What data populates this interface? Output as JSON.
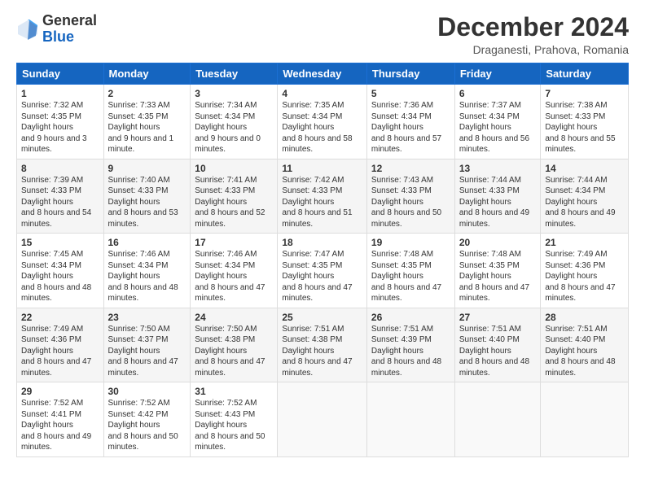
{
  "header": {
    "logo_general": "General",
    "logo_blue": "Blue",
    "month_title": "December 2024",
    "location": "Draganesti, Prahova, Romania"
  },
  "days_of_week": [
    "Sunday",
    "Monday",
    "Tuesday",
    "Wednesday",
    "Thursday",
    "Friday",
    "Saturday"
  ],
  "weeks": [
    [
      {
        "day": 1,
        "sunrise": "7:32 AM",
        "sunset": "4:35 PM",
        "daylight": "9 hours and 3 minutes."
      },
      {
        "day": 2,
        "sunrise": "7:33 AM",
        "sunset": "4:35 PM",
        "daylight": "9 hours and 1 minute."
      },
      {
        "day": 3,
        "sunrise": "7:34 AM",
        "sunset": "4:34 PM",
        "daylight": "9 hours and 0 minutes."
      },
      {
        "day": 4,
        "sunrise": "7:35 AM",
        "sunset": "4:34 PM",
        "daylight": "8 hours and 58 minutes."
      },
      {
        "day": 5,
        "sunrise": "7:36 AM",
        "sunset": "4:34 PM",
        "daylight": "8 hours and 57 minutes."
      },
      {
        "day": 6,
        "sunrise": "7:37 AM",
        "sunset": "4:34 PM",
        "daylight": "8 hours and 56 minutes."
      },
      {
        "day": 7,
        "sunrise": "7:38 AM",
        "sunset": "4:33 PM",
        "daylight": "8 hours and 55 minutes."
      }
    ],
    [
      {
        "day": 8,
        "sunrise": "7:39 AM",
        "sunset": "4:33 PM",
        "daylight": "8 hours and 54 minutes."
      },
      {
        "day": 9,
        "sunrise": "7:40 AM",
        "sunset": "4:33 PM",
        "daylight": "8 hours and 53 minutes."
      },
      {
        "day": 10,
        "sunrise": "7:41 AM",
        "sunset": "4:33 PM",
        "daylight": "8 hours and 52 minutes."
      },
      {
        "day": 11,
        "sunrise": "7:42 AM",
        "sunset": "4:33 PM",
        "daylight": "8 hours and 51 minutes."
      },
      {
        "day": 12,
        "sunrise": "7:43 AM",
        "sunset": "4:33 PM",
        "daylight": "8 hours and 50 minutes."
      },
      {
        "day": 13,
        "sunrise": "7:44 AM",
        "sunset": "4:33 PM",
        "daylight": "8 hours and 49 minutes."
      },
      {
        "day": 14,
        "sunrise": "7:44 AM",
        "sunset": "4:34 PM",
        "daylight": "8 hours and 49 minutes."
      }
    ],
    [
      {
        "day": 15,
        "sunrise": "7:45 AM",
        "sunset": "4:34 PM",
        "daylight": "8 hours and 48 minutes."
      },
      {
        "day": 16,
        "sunrise": "7:46 AM",
        "sunset": "4:34 PM",
        "daylight": "8 hours and 48 minutes."
      },
      {
        "day": 17,
        "sunrise": "7:46 AM",
        "sunset": "4:34 PM",
        "daylight": "8 hours and 47 minutes."
      },
      {
        "day": 18,
        "sunrise": "7:47 AM",
        "sunset": "4:35 PM",
        "daylight": "8 hours and 47 minutes."
      },
      {
        "day": 19,
        "sunrise": "7:48 AM",
        "sunset": "4:35 PM",
        "daylight": "8 hours and 47 minutes."
      },
      {
        "day": 20,
        "sunrise": "7:48 AM",
        "sunset": "4:35 PM",
        "daylight": "8 hours and 47 minutes."
      },
      {
        "day": 21,
        "sunrise": "7:49 AM",
        "sunset": "4:36 PM",
        "daylight": "8 hours and 47 minutes."
      }
    ],
    [
      {
        "day": 22,
        "sunrise": "7:49 AM",
        "sunset": "4:36 PM",
        "daylight": "8 hours and 47 minutes."
      },
      {
        "day": 23,
        "sunrise": "7:50 AM",
        "sunset": "4:37 PM",
        "daylight": "8 hours and 47 minutes."
      },
      {
        "day": 24,
        "sunrise": "7:50 AM",
        "sunset": "4:38 PM",
        "daylight": "8 hours and 47 minutes."
      },
      {
        "day": 25,
        "sunrise": "7:51 AM",
        "sunset": "4:38 PM",
        "daylight": "8 hours and 47 minutes."
      },
      {
        "day": 26,
        "sunrise": "7:51 AM",
        "sunset": "4:39 PM",
        "daylight": "8 hours and 48 minutes."
      },
      {
        "day": 27,
        "sunrise": "7:51 AM",
        "sunset": "4:40 PM",
        "daylight": "8 hours and 48 minutes."
      },
      {
        "day": 28,
        "sunrise": "7:51 AM",
        "sunset": "4:40 PM",
        "daylight": "8 hours and 48 minutes."
      }
    ],
    [
      {
        "day": 29,
        "sunrise": "7:52 AM",
        "sunset": "4:41 PM",
        "daylight": "8 hours and 49 minutes."
      },
      {
        "day": 30,
        "sunrise": "7:52 AM",
        "sunset": "4:42 PM",
        "daylight": "8 hours and 50 minutes."
      },
      {
        "day": 31,
        "sunrise": "7:52 AM",
        "sunset": "4:43 PM",
        "daylight": "8 hours and 50 minutes."
      },
      null,
      null,
      null,
      null
    ]
  ]
}
